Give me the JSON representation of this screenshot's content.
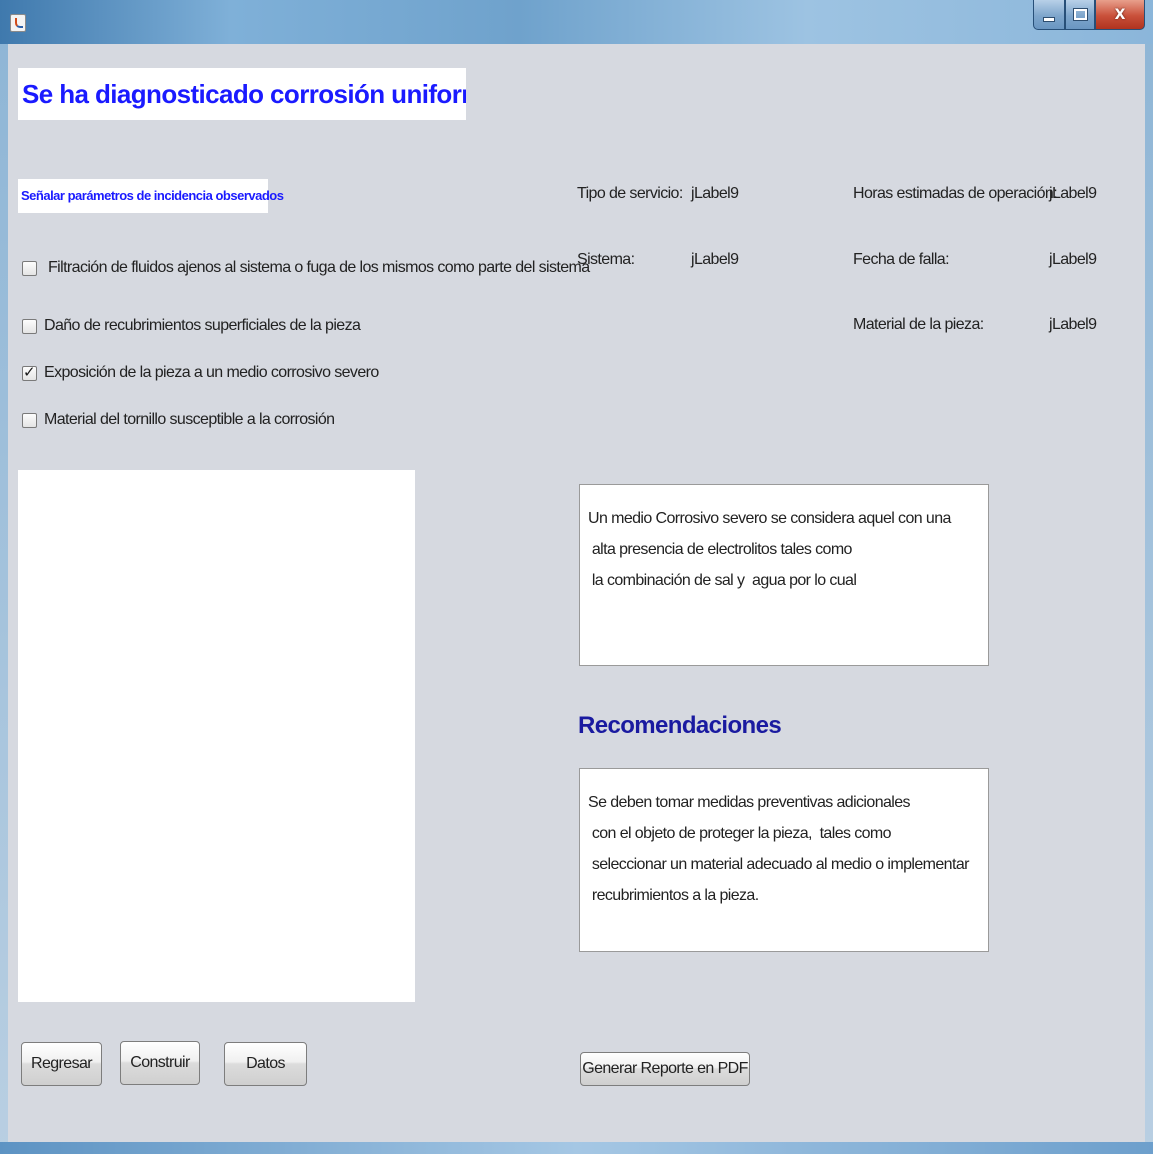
{
  "window": {
    "icon": "java-cup-icon",
    "controls": {
      "minimize": "minimize-icon",
      "maximize": "maximize-icon",
      "close_label": "X"
    }
  },
  "header": {
    "title": "Se ha diagnosticado corrosión uniforme en la pieza",
    "subtitle": "Señalar parámetros de incidencia observados"
  },
  "checkboxes": [
    {
      "label": "Filtración de fluidos ajenos al sistema o fuga de los mismos como parte del sistema",
      "checked": false
    },
    {
      "label": "Daño de recubrimientos superficiales de la pieza",
      "checked": false
    },
    {
      "label": "Exposición de la pieza a un medio corrosivo severo",
      "checked": true
    },
    {
      "label": "Material del tornillo susceptible a la corrosión",
      "checked": false
    }
  ],
  "info": {
    "tipo_servicio_label": "Tipo de servicio:",
    "tipo_servicio_value": "jLabel9",
    "sistema_label": "Sistema:",
    "sistema_value": "jLabel9",
    "horas_label": "Horas estimadas de operación:",
    "horas_value": "jLabel9",
    "fecha_label": "Fecha de falla:",
    "fecha_value": "jLabel9",
    "material_label": "Material de la pieza:",
    "material_value": "jLabel9"
  },
  "description": {
    "lines": [
      "Un medio Corrosivo severo se considera aquel con una",
      " alta presencia de electrolitos tales como",
      " la combinación de sal y  agua por lo cual"
    ]
  },
  "recommendations": {
    "heading": "Recomendaciones",
    "lines": [
      "Se deben tomar medidas preventivas adicionales",
      " con el objeto de proteger la pieza,  tales como",
      " seleccionar un material adecuado al medio o implementar",
      " recubrimientos a la pieza."
    ]
  },
  "buttons": {
    "regresar": "Regresar",
    "construir": "Construir",
    "datos": "Datos",
    "generar_pdf": "Generar Reporte en PDF"
  }
}
